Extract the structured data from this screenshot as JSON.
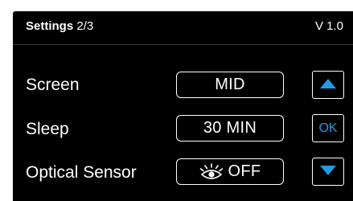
{
  "header": {
    "title": "Settings",
    "page": "2/3",
    "version": "V 1.0"
  },
  "rows": [
    {
      "label": "Screen",
      "value": "MID"
    },
    {
      "label": "Sleep",
      "value": "30 MIN"
    },
    {
      "label": "Optical Sensor",
      "value": "OFF",
      "icon": "eye-icon"
    }
  ],
  "nav": {
    "up_icon": "triangle-up-icon",
    "ok_label": "OK",
    "down_icon": "triangle-down-icon"
  },
  "colors": {
    "background": "#000000",
    "foreground": "#ffffff",
    "accent": "#1e9be6"
  }
}
